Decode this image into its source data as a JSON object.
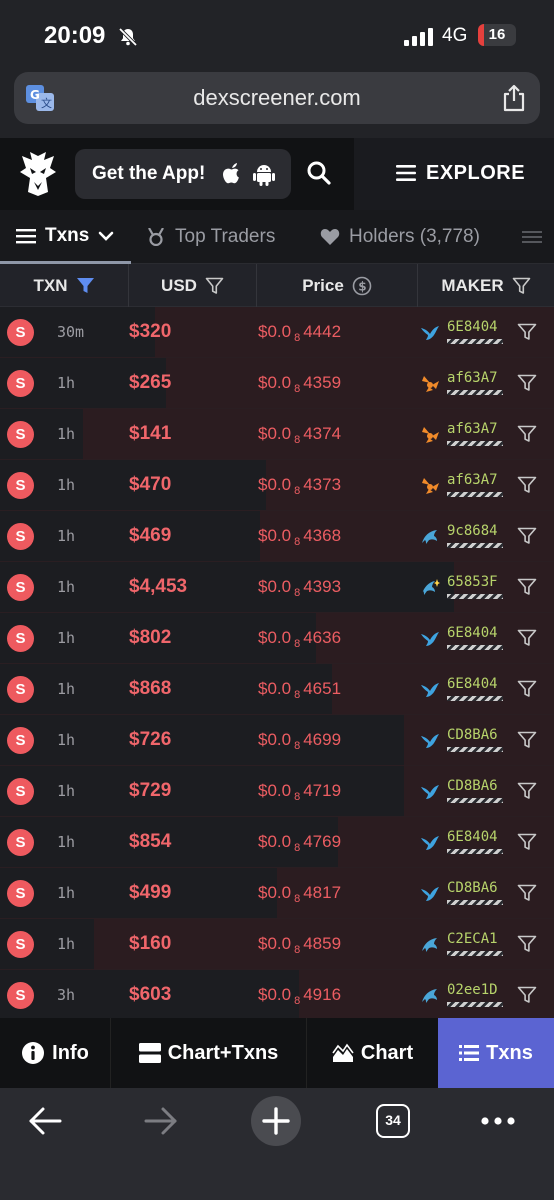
{
  "status": {
    "time": "20:09",
    "network": "4G",
    "battery": "16",
    "battery_level": 0.16
  },
  "browser": {
    "url": "dexscreener.com",
    "tab_count": "34"
  },
  "header": {
    "get_app_label": "Get the App!",
    "explore_label": "EXPLORE"
  },
  "tabs": {
    "txns": "Txns",
    "top_traders": "Top Traders",
    "holders": "Holders (3,778)"
  },
  "table": {
    "headers": {
      "txn": "TXN",
      "usd": "USD",
      "price": "Price",
      "maker": "MAKER"
    },
    "rows": [
      {
        "type": "S",
        "age": "30m",
        "usd": "$320",
        "price_prefix": "$0.0",
        "price_zeros": "8",
        "price_digits": "4442",
        "maker": "6E8404",
        "icon": "bird-icon",
        "icon_color": "#3ea3e0",
        "bar": 0.72
      },
      {
        "type": "S",
        "age": "1h",
        "usd": "$265",
        "price_prefix": "$0.0",
        "price_zeros": "8",
        "price_digits": "4359",
        "maker": "af63A7",
        "icon": "pinwheel-icon",
        "icon_color": "#f08a2a",
        "bar": 0.7
      },
      {
        "type": "S",
        "age": "1h",
        "usd": "$141",
        "price_prefix": "$0.0",
        "price_zeros": "8",
        "price_digits": "4374",
        "maker": "af63A7",
        "icon": "pinwheel-icon",
        "icon_color": "#f08a2a",
        "bar": 0.85
      },
      {
        "type": "S",
        "age": "1h",
        "usd": "$470",
        "price_prefix": "$0.0",
        "price_zeros": "8",
        "price_digits": "4373",
        "maker": "af63A7",
        "icon": "pinwheel-icon",
        "icon_color": "#f08a2a",
        "bar": 0.52
      },
      {
        "type": "S",
        "age": "1h",
        "usd": "$469",
        "price_prefix": "$0.0",
        "price_zeros": "8",
        "price_digits": "4368",
        "maker": "9c8684",
        "icon": "dolphin-icon",
        "icon_color": "#4aa6d8",
        "bar": 0.53
      },
      {
        "type": "S",
        "age": "1h",
        "usd": "$4,453",
        "price_prefix": "$0.0",
        "price_zeros": "8",
        "price_digits": "4393",
        "maker": "65853F",
        "icon": "sparkle-dolphin-icon",
        "icon_color": "#4aa6d8",
        "bar": 0.18
      },
      {
        "type": "S",
        "age": "1h",
        "usd": "$802",
        "price_prefix": "$0.0",
        "price_zeros": "8",
        "price_digits": "4636",
        "maker": "6E8404",
        "icon": "bird-icon",
        "icon_color": "#3ea3e0",
        "bar": 0.43
      },
      {
        "type": "S",
        "age": "1h",
        "usd": "$868",
        "price_prefix": "$0.0",
        "price_zeros": "8",
        "price_digits": "4651",
        "maker": "6E8404",
        "icon": "bird-icon",
        "icon_color": "#3ea3e0",
        "bar": 0.4
      },
      {
        "type": "S",
        "age": "1h",
        "usd": "$726",
        "price_prefix": "$0.0",
        "price_zeros": "8",
        "price_digits": "4699",
        "maker": "CD8BA6",
        "icon": "bird-icon",
        "icon_color": "#3ea3e0",
        "bar": 0.27
      },
      {
        "type": "S",
        "age": "1h",
        "usd": "$729",
        "price_prefix": "$0.0",
        "price_zeros": "8",
        "price_digits": "4719",
        "maker": "CD8BA6",
        "icon": "bird-icon",
        "icon_color": "#3ea3e0",
        "bar": 0.27
      },
      {
        "type": "S",
        "age": "1h",
        "usd": "$854",
        "price_prefix": "$0.0",
        "price_zeros": "8",
        "price_digits": "4769",
        "maker": "6E8404",
        "icon": "bird-icon",
        "icon_color": "#3ea3e0",
        "bar": 0.39
      },
      {
        "type": "S",
        "age": "1h",
        "usd": "$499",
        "price_prefix": "$0.0",
        "price_zeros": "8",
        "price_digits": "4817",
        "maker": "CD8BA6",
        "icon": "bird-icon",
        "icon_color": "#3ea3e0",
        "bar": 0.5
      },
      {
        "type": "S",
        "age": "1h",
        "usd": "$160",
        "price_prefix": "$0.0",
        "price_zeros": "8",
        "price_digits": "4859",
        "maker": "C2ECA1",
        "icon": "dolphin-icon",
        "icon_color": "#4aa6d8",
        "bar": 0.83
      },
      {
        "type": "S",
        "age": "3h",
        "usd": "$603",
        "price_prefix": "$0.0",
        "price_zeros": "8",
        "price_digits": "4916",
        "maker": "02ee1D",
        "icon": "dolphin-icon",
        "icon_color": "#4aa6d8",
        "bar": 0.46
      }
    ]
  },
  "bottom_nav": {
    "info": "Info",
    "chart_txns": "Chart+Txns",
    "chart": "Chart",
    "txns": "Txns"
  },
  "colors": {
    "sell": "#ee5a5f",
    "accent": "#5b64d2",
    "maker_id": "#b7d36b"
  }
}
